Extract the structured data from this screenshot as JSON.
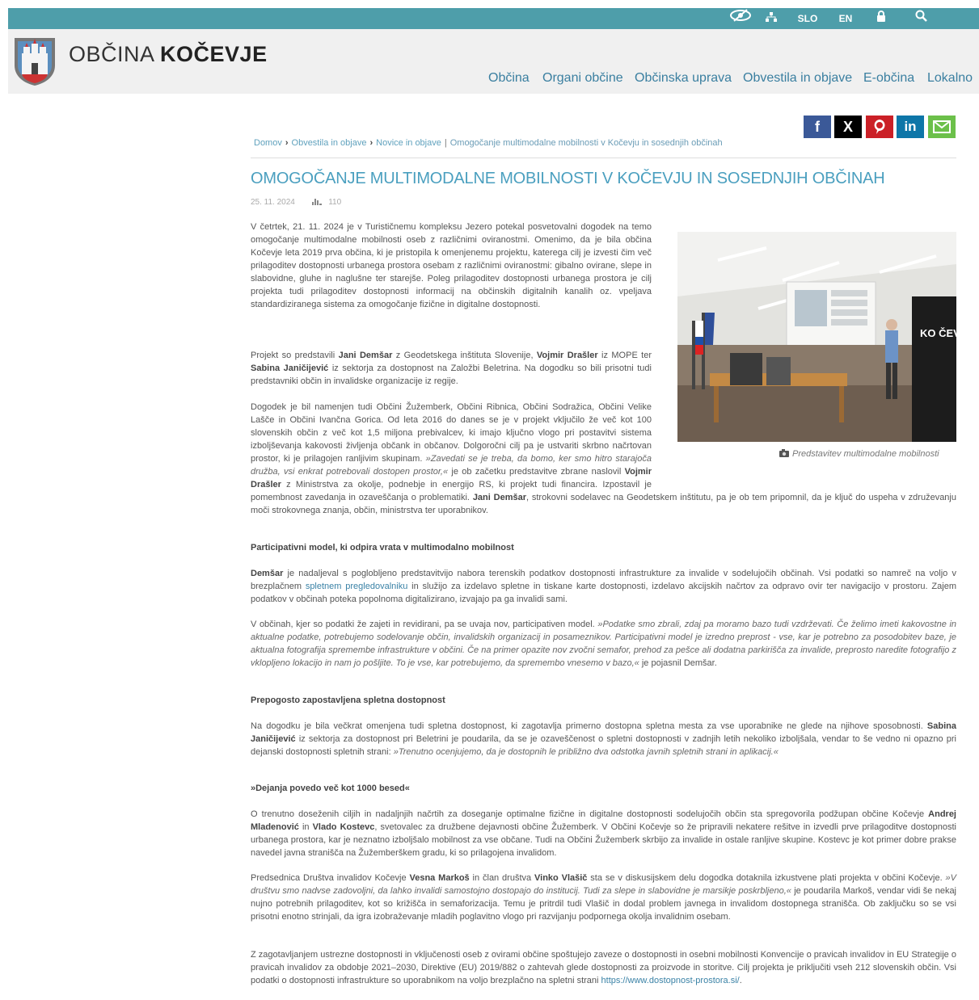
{
  "topbar": {
    "accessibility_icon": "eye-slash-icon",
    "sitemap_icon": "sitemap-icon",
    "lang_slo": "SLO",
    "lang_en": "EN",
    "login_icon": "lock-icon",
    "search_icon": "search-icon"
  },
  "brand": {
    "prefix": "OBČINA ",
    "name": "KOČEVJE"
  },
  "nav": {
    "items": [
      "Občina",
      "Organi občine",
      "Občinska uprava",
      "Obvestila in objave",
      "E-občina",
      "Lokalno"
    ]
  },
  "share": {
    "facebook": "f",
    "x": "X",
    "pinterest": "P",
    "linkedin": "in",
    "email": "email-icon"
  },
  "breadcrumb": {
    "home": "Domov",
    "level1": "Obvestila in objave",
    "level2": "Novice in objave",
    "current": "Omogočanje multimodalne mobilnosti v Kočevju in sosednjih občinah"
  },
  "article": {
    "title": "OMOGOČANJE MULTIMODALNE MOBILNOSTI V KOČEVJU IN SOSEDNJIH OBČINAH",
    "date": "25. 11. 2024",
    "views": "110",
    "p1": "V četrtek, 21. 11. 2024 je v Turističnemu kompleksu Jezero potekal posvetovalni dogodek na temo omogočanje multimodalne mobilnosti oseb z različnimi oviranostmi. Omenimo, da je bila občina Kočevje leta 2019 prva občina, ki je pristopila k omenjenemu projektu, katerega cilj je izvesti čim več prilagoditev dostopnosti urbanega prostora osebam z različnimi oviranostmi: gibalno ovirane, slepe in slabovidne, gluhe in naglušne ter starejše. Poleg prilagoditev dostopnosti urbanega prostora je cilj projekta tudi prilagoditev dostopnosti informacij na občinskih digitalnih kanalih oz. vpeljava standardiziranega sistema za omogočanje fizične in digitalne dostopnosti.",
    "p2_a": "Projekt so predstavili ",
    "p2_b1": "Jani Demšar",
    "p2_c": " z Geodetskega inštituta Slovenije, ",
    "p2_b2": "Vojmir Drašler",
    "p2_d": " iz MOPE ter ",
    "p2_b3": "Sabina Janičijević",
    "p2_e": " iz sektorja za dostopnost na Založbi Beletrina. Na dogodku so bili prisotni tudi predstavniki občin in invalidske organizacije iz regije.",
    "p3_a": "Dogodek je bil namenjen tudi Občini Žužemberk, Občini Ribnica, Občini Sodražica, Občini Velike Lašče in Občini Ivančna Gorica. Od leta 2016 do danes se je v projekt vključilo že več kot 100 slovenskih občin z več kot 1,5 miljona prebivalcev, ki imajo ključno vlogo pri postavitvi sistema izboljševanja kakovosti življenja občank in občanov. Dolgoročni cilj pa je ustvariti skrbno načrtovan prostor, ki je prilagojen ranljivim skupinam. ",
    "p3_q": "»Zavedati se je treba, da bomo, ker smo hitro starajoča družba, vsi enkrat potrebovali dostopen prostor,«",
    "p3_b": " je ob začetku predstavitve zbrane naslovil ",
    "p3_n1": "Vojmir Drašler",
    "p3_c": " z Ministrstva za okolje, podnebje in energijo RS, ki projekt tudi financira. Izpostavil je pomembnost zavedanja in ozaveščanja o problematiki. ",
    "p3_n2": "Jani Demšar",
    "p3_d": ", strokovni sodelavec na Geodetskem inštitutu, pa je ob tem pripomnil, da je ključ do uspeha v združevanju moči strokovnega znanja, občin, ministrstva ter uporabnikov.",
    "h1": "Participativni model, ki odpira vrata v multimodalno mobilnost",
    "p4_n": "Demšar",
    "p4_a": " je nadaljeval s poglobljeno predstavitvijo nabora terenskih podatkov dostopnosti infrastrukture za invalide v sodelujočih občinah. Vsi podatki so namreč na voljo v brezplačnem ",
    "p4_link": "spletnem pregledovalniku",
    "p4_b": " in služijo za izdelavo spletne in tiskane karte dostopnosti, izdelavo akcijskih načrtov za odpravo ovir ter navigacijo v prostoru. Zajem podatkov v občinah poteka popolnoma digitalizirano, izvajajo pa ga invalidi sami.",
    "p5_a": "V občinah, kjer so podatki že zajeti in revidirani, pa se uvaja nov, participativen model. ",
    "p5_q": "»Podatke smo zbrali, zdaj pa moramo bazo tudi vzdrževati. Če želimo imeti kakovostne in aktualne podatke, potrebujemo sodelovanje občin, invalidskih organizacij in posameznikov. Participativni model je izredno preprost - vse, kar je potrebno za posodobitev baze, je aktualna fotografija spremembe infrastrukture v občini. Če na primer opazite nov zvočni semafor, prehod za pešce ali dodatna parkirišča za invalide, preprosto naredite fotografijo z vklopljeno lokacijo in nam jo pošljite. To je vse, kar potrebujemo, da spremembo vnesemo v bazo,«",
    "p5_b": " je pojasnil Demšar.",
    "h2": "Prepogosto zapostavljena spletna dostopnost",
    "p6_a": "Na dogodku je bila večkrat omenjena tudi spletna dostopnost, ki zagotavlja primerno dostopna spletna mesta za vse uporabnike ne glede na njihove sposobnosti. ",
    "p6_n": "Sabina Janičijević",
    "p6_b": " iz sektorja za dostopnost pri Beletrini je poudarila, da se je ozaveščenost o spletni dostopnosti v zadnjih letih nekoliko izboljšala, vendar to še vedno ni opazno pri dejanski dostopnosti spletnih strani: ",
    "p6_q": "»Trenutno ocenjujemo, da je dostopnih le približno dva odstotka javnih spletnih strani in aplikacij.«",
    "h3": "»Dejanja povedo več kot 1000 besed«",
    "p7_a": "O trenutno doseženih ciljih in nadaljnjih načrtih za doseganje optimalne fizične in digitalne dostopnosti sodelujočih občin sta spregovorila podžupan občine Kočevje ",
    "p7_n1": "Andrej Mladenović",
    "p7_b": " in ",
    "p7_n2": "Vlado Kostevc",
    "p7_c": ", svetovalec za družbene dejavnosti občine Žužemberk. V Občini Kočevje so že pripravili nekatere rešitve in izvedli prve prilagoditve dostopnosti urbanega prostora, kar je neznatno izboljšalo mobilnost za vse občane. Tudi na Občini Žužemberk skrbijo za invalide in ostale ranljive skupine. Kostevc je kot primer dobre prakse navedel javna stranišča na Žužemberškem gradu, ki so prilagojena invalidom.",
    "p8_a": "Predsednica Društva invalidov Kočevje ",
    "p8_n1": "Vesna Markoš",
    "p8_b": " in član društva ",
    "p8_n2": "Vinko Vlašič",
    "p8_c": " sta se v diskusijskem delu dogodka dotaknila izkustvene plati projekta v občini Kočevje. ",
    "p8_q": "»V društvu smo nadvse zadovoljni, da lahko invalidi samostojno dostopajo do institucij. Tudi za slepe in slabovidne je marsikje poskrbljeno,«",
    "p8_d": " je poudarila Markoš, vendar vidi še nekaj nujno potrebnih prilagoditev, kot so križišča in semaforizacija. Temu je pritrdil tudi Vlašič in dodal problem javnega in invalidom dostopnega stranišča. Ob zaključku so se vsi prisotni enotno strinjali, da igra izobraževanje mladih poglavitno vlogo pri razvijanju podpornega okolja invalidnim osebam.",
    "p9_a": "Z zagotavljanjem ustrezne dostopnosti in vključenosti oseb z ovirami občine spoštujejo zaveze o dostopnosti in osebni mobilnosti Konvencije o pravicah invalidov in EU Strategije o pravicah invalidov za obdobje 2021–2030, Direktive (EU) 2019/882 o zahtevah glede dostopnosti za proizvode in storitve. Cilj projekta je priključiti vseh 212 slovenskih občin. Vsi podatki o dostopnosti infrastrukture so uporabnikom na voljo brezplačno na spletni strani ",
    "p9_link": "https://www.dostopnost-prostora.si/",
    "p9_b": ".",
    "photo_caption": "Predstavitev multimodalne mobilnosti",
    "photo_banner": "KO ČEV SKO"
  },
  "colors": {
    "topbar": "#4e9eaa",
    "header_bg": "#f0f0f0",
    "link": "#3a7fa0",
    "title": "#4a9fbf",
    "facebook": "#3b5998",
    "x": "#000000",
    "pinterest": "#cb2027",
    "linkedin": "#0e76a8",
    "email": "#6cc04a"
  }
}
